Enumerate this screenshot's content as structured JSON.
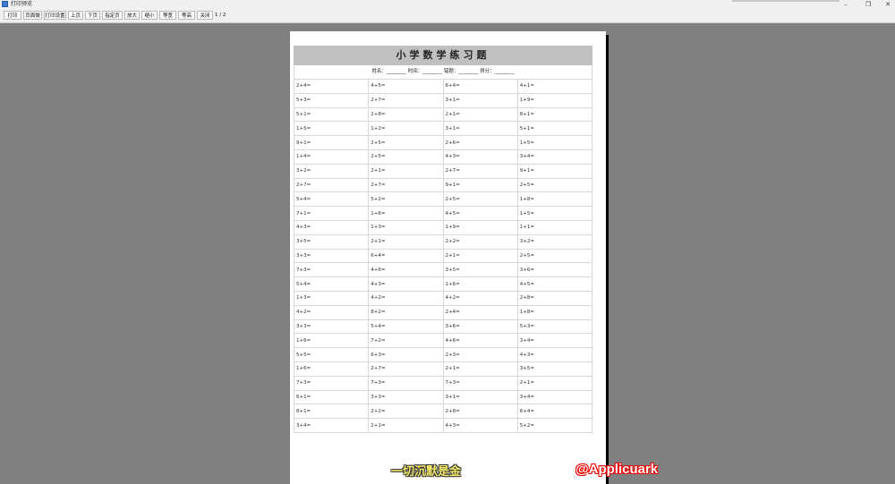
{
  "window": {
    "title": "打印预览",
    "controls": [
      "–",
      "❐",
      "✕"
    ]
  },
  "toolbar": {
    "buttons": [
      "打印",
      "页面微",
      "打印设置",
      "上页",
      "下页",
      "指定页",
      "放大",
      "缩小",
      "等宽",
      "等高",
      "关闭"
    ],
    "page_info": "1 / 2"
  },
  "worksheet": {
    "title": "小学数学练习题",
    "info_line": "姓名：________  时间：________  错题：________  得分：________",
    "rows": [
      [
        "2+4=",
        "4+5=",
        "6+4=",
        "4+1="
      ],
      [
        "5+3=",
        "2+7=",
        "3+1=",
        "1+9="
      ],
      [
        "5+1=",
        "2+8=",
        "2+1=",
        "8+1="
      ],
      [
        "1+5=",
        "1+2=",
        "3+1=",
        "5+1="
      ],
      [
        "9+1=",
        "2+5=",
        "2+6=",
        "1+5="
      ],
      [
        "1+4=",
        "2+5=",
        "4+3=",
        "3+4="
      ],
      [
        "3+2=",
        "2+1=",
        "2+7=",
        "9+1="
      ],
      [
        "2+7=",
        "2+7=",
        "9+1=",
        "2+5="
      ],
      [
        "5+4=",
        "5+2=",
        "2+5=",
        "1+8="
      ],
      [
        "7+1=",
        "1+6=",
        "4+5=",
        "1+5="
      ],
      [
        "4+3=",
        "1+3=",
        "1+9=",
        "1+1="
      ],
      [
        "3+5=",
        "2+1=",
        "2+2=",
        "3+2="
      ],
      [
        "3+3=",
        "6+4=",
        "2+1=",
        "2+5="
      ],
      [
        "7+3=",
        "4+6=",
        "3+5=",
        "3+6="
      ],
      [
        "5+4=",
        "4+3=",
        "1+6=",
        "4+5="
      ],
      [
        "1+3=",
        "4+2=",
        "4+2=",
        "2+8="
      ],
      [
        "4+2=",
        "8+2=",
        "2+4=",
        "1+8="
      ],
      [
        "3+3=",
        "5+4=",
        "3+6=",
        "5+3="
      ],
      [
        "1+6=",
        "7+2=",
        "4+6=",
        "3+4="
      ],
      [
        "5+5=",
        "6+3=",
        "2+3=",
        "4+3="
      ],
      [
        "1+6=",
        "2+7=",
        "2+1=",
        "3+5="
      ],
      [
        "7+3=",
        "7+3=",
        "7+3=",
        "2+1="
      ],
      [
        "6+1=",
        "3+3=",
        "3+1=",
        "3+4="
      ],
      [
        "8+1=",
        "2+2=",
        "2+8=",
        "6+4="
      ],
      [
        "3+4=",
        "2+1=",
        "4+3=",
        "5+2="
      ]
    ]
  },
  "watermarks": {
    "left": "一切沉默是金",
    "right": "@Applicuark"
  }
}
